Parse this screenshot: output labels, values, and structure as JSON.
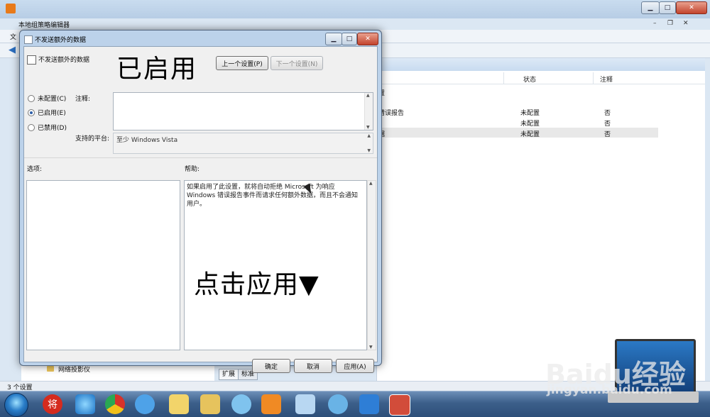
{
  "background_window": {
    "title": "本地组策略编辑器",
    "menu_item": "文",
    "columns": {
      "state": "状态",
      "note": "注释"
    },
    "rows": [
      {
        "name": "置",
        "state": "",
        "note": ""
      },
      {
        "name": "错误报告",
        "state": "未配置",
        "note": "否"
      },
      {
        "name": "",
        "state": "未配置",
        "note": "否"
      },
      {
        "name": "据",
        "state": "未配置",
        "note": "否"
      }
    ],
    "left_tree_item": "网络投影仪",
    "tabs": {
      "extended": "扩展",
      "standard": "标准"
    },
    "status": "3 个设置"
  },
  "dialog": {
    "title": "不发送额外的数据",
    "policy_name": "不发送额外的数据",
    "buttons": {
      "prev": "上一个设置(P)",
      "next": "下一个设置(N)",
      "ok": "确定",
      "cancel": "取消",
      "apply": "应用(A)"
    },
    "radios": {
      "not_configured": "未配置(C)",
      "enabled": "已启用(E)",
      "disabled": "已禁用(D)",
      "selected": "enabled"
    },
    "labels": {
      "note": "注释:",
      "platform": "支持的平台:",
      "options": "选项:",
      "help": "帮助:"
    },
    "platform_value": "至少 Windows Vista",
    "help_text": "如果启用了此设置，就将自动拒绝 Microsoft 为响应 Windows 错误报告事件而请求任何额外数据，而且不会通知用户。"
  },
  "annotations": {
    "enabled_overlay": "已启用",
    "click_apply_overlay": "点击应用▼"
  },
  "taskbar": {
    "red_icon_glyph": "将"
  },
  "watermark": {
    "logo": "Baidu经验",
    "url": "jingyan.baidu.com"
  },
  "colors": {
    "accent": "#2e5fa8",
    "close_red": "#c2432c",
    "dialog_frame": "#bcd2ea"
  }
}
